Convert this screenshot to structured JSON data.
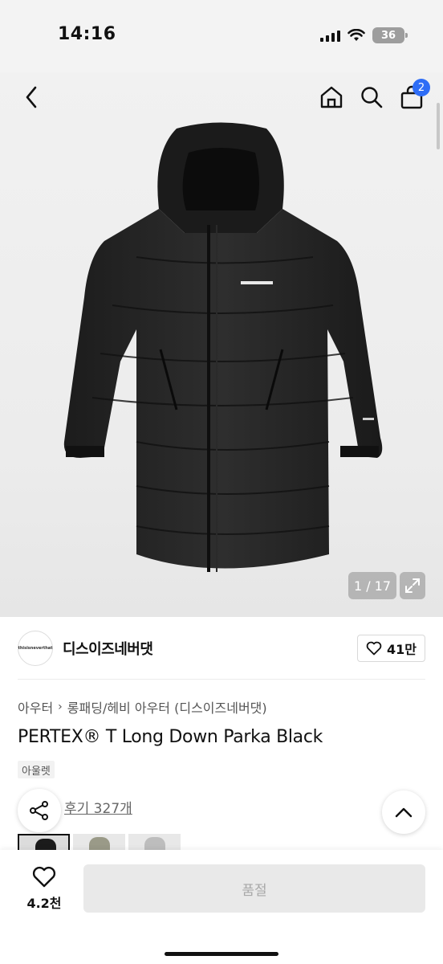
{
  "status_bar": {
    "time": "14:16",
    "battery": "36"
  },
  "header": {
    "cart_count": "2"
  },
  "hero": {
    "image_counter": "1 / 17"
  },
  "brand": {
    "logo_text": "thisisneverthat",
    "name": "디스이즈네버댓",
    "likes": "41만"
  },
  "breadcrumb": {
    "category": "아우터",
    "subcategory": "롱패딩/헤비 아우터 (디스이즈네버댓)"
  },
  "product": {
    "title": "PERTEX® T Long Down Parka Black",
    "tag": "아울렛",
    "reviews": "후기 327개"
  },
  "bottom": {
    "wish_count": "4.2천",
    "buy_label": "품절"
  },
  "colors": {
    "badge": "#2e6df6",
    "disabled_bg": "#e9e9e9",
    "disabled_text": "#a8a8a8"
  },
  "icons": [
    "back-icon",
    "home-icon",
    "search-icon",
    "cart-icon",
    "expand-icon",
    "heart-icon",
    "share-icon",
    "chevron-up-icon"
  ]
}
